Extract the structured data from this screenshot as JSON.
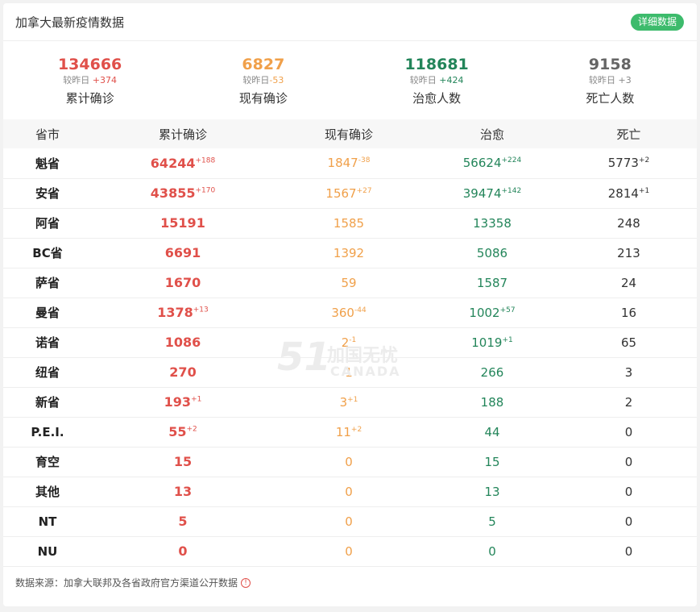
{
  "header": {
    "title": "加拿大最新疫情数据",
    "detail_button": "详细数据"
  },
  "summary": [
    {
      "value": "134666",
      "compare_label": "较昨日",
      "compare_value": "+374",
      "label": "累计确诊",
      "color": "#e0504a"
    },
    {
      "value": "6827",
      "compare_label": "较昨日",
      "compare_value": "-53",
      "label": "现有确诊",
      "color": "#f0a04a"
    },
    {
      "value": "118681",
      "compare_label": "较昨日",
      "compare_value": "+424",
      "label": "治愈人数",
      "color": "#23855a"
    },
    {
      "value": "9158",
      "compare_label": "较昨日",
      "compare_value": "+3",
      "label": "死亡人数",
      "color": "#666666"
    }
  ],
  "table": {
    "headers": [
      "省市",
      "累计确诊",
      "现有确诊",
      "治愈",
      "死亡"
    ],
    "rows": [
      {
        "prov": "魁省",
        "conf": "64244",
        "conf_inc": "+188",
        "cur": "1847",
        "cur_inc": "-38",
        "heal": "56624",
        "heal_inc": "+224",
        "dead": "5773",
        "dead_inc": "+2"
      },
      {
        "prov": "安省",
        "conf": "43855",
        "conf_inc": "+170",
        "cur": "1567",
        "cur_inc": "+27",
        "heal": "39474",
        "heal_inc": "+142",
        "dead": "2814",
        "dead_inc": "+1"
      },
      {
        "prov": "阿省",
        "conf": "15191",
        "conf_inc": "",
        "cur": "1585",
        "cur_inc": "",
        "heal": "13358",
        "heal_inc": "",
        "dead": "248",
        "dead_inc": ""
      },
      {
        "prov": "BC省",
        "conf": "6691",
        "conf_inc": "",
        "cur": "1392",
        "cur_inc": "",
        "heal": "5086",
        "heal_inc": "",
        "dead": "213",
        "dead_inc": ""
      },
      {
        "prov": "萨省",
        "conf": "1670",
        "conf_inc": "",
        "cur": "59",
        "cur_inc": "",
        "heal": "1587",
        "heal_inc": "",
        "dead": "24",
        "dead_inc": ""
      },
      {
        "prov": "曼省",
        "conf": "1378",
        "conf_inc": "+13",
        "cur": "360",
        "cur_inc": "-44",
        "heal": "1002",
        "heal_inc": "+57",
        "dead": "16",
        "dead_inc": ""
      },
      {
        "prov": "诺省",
        "conf": "1086",
        "conf_inc": "",
        "cur": "2",
        "cur_inc": "-1",
        "heal": "1019",
        "heal_inc": "+1",
        "dead": "65",
        "dead_inc": ""
      },
      {
        "prov": "纽省",
        "conf": "270",
        "conf_inc": "",
        "cur": "1",
        "cur_inc": "",
        "heal": "266",
        "heal_inc": "",
        "dead": "3",
        "dead_inc": ""
      },
      {
        "prov": "新省",
        "conf": "193",
        "conf_inc": "+1",
        "cur": "3",
        "cur_inc": "+1",
        "heal": "188",
        "heal_inc": "",
        "dead": "2",
        "dead_inc": ""
      },
      {
        "prov": "P.E.I.",
        "conf": "55",
        "conf_inc": "+2",
        "cur": "11",
        "cur_inc": "+2",
        "heal": "44",
        "heal_inc": "",
        "dead": "0",
        "dead_inc": ""
      },
      {
        "prov": "育空",
        "conf": "15",
        "conf_inc": "",
        "cur": "0",
        "cur_inc": "",
        "heal": "15",
        "heal_inc": "",
        "dead": "0",
        "dead_inc": ""
      },
      {
        "prov": "其他",
        "conf": "13",
        "conf_inc": "",
        "cur": "0",
        "cur_inc": "",
        "heal": "13",
        "heal_inc": "",
        "dead": "0",
        "dead_inc": ""
      },
      {
        "prov": "NT",
        "conf": "5",
        "conf_inc": "",
        "cur": "0",
        "cur_inc": "",
        "heal": "5",
        "heal_inc": "",
        "dead": "0",
        "dead_inc": ""
      },
      {
        "prov": "NU",
        "conf": "0",
        "conf_inc": "",
        "cur": "0",
        "cur_inc": "",
        "heal": "0",
        "heal_inc": "",
        "dead": "0",
        "dead_inc": ""
      }
    ]
  },
  "footer": {
    "source": "数据来源：加拿大联邦及各省政府官方渠道公开数据"
  },
  "watermark": {
    "logo": "51",
    "text": "加国无忧",
    "sub": "CANADA"
  }
}
